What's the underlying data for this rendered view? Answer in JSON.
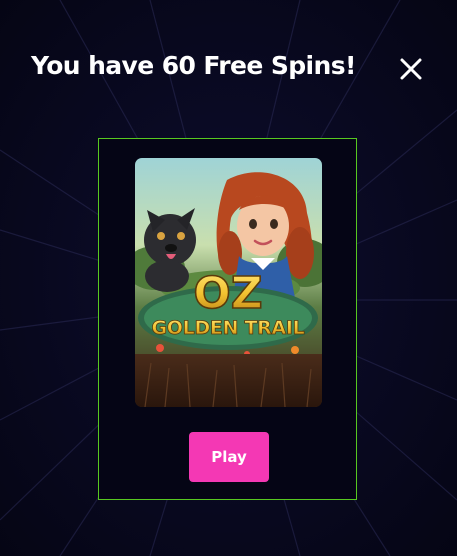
{
  "modal": {
    "title": "You have 60 Free Spins!",
    "close_icon": "close-icon"
  },
  "game": {
    "title_line1": "OZ",
    "title_line2": "GOLDEN TRAIL",
    "play_label": "Play"
  },
  "colors": {
    "background": "#07071a",
    "card_border": "#57c820",
    "play_button": "#f438b4",
    "title_text": "#ffffff",
    "logo_gold": "#f2c230"
  }
}
